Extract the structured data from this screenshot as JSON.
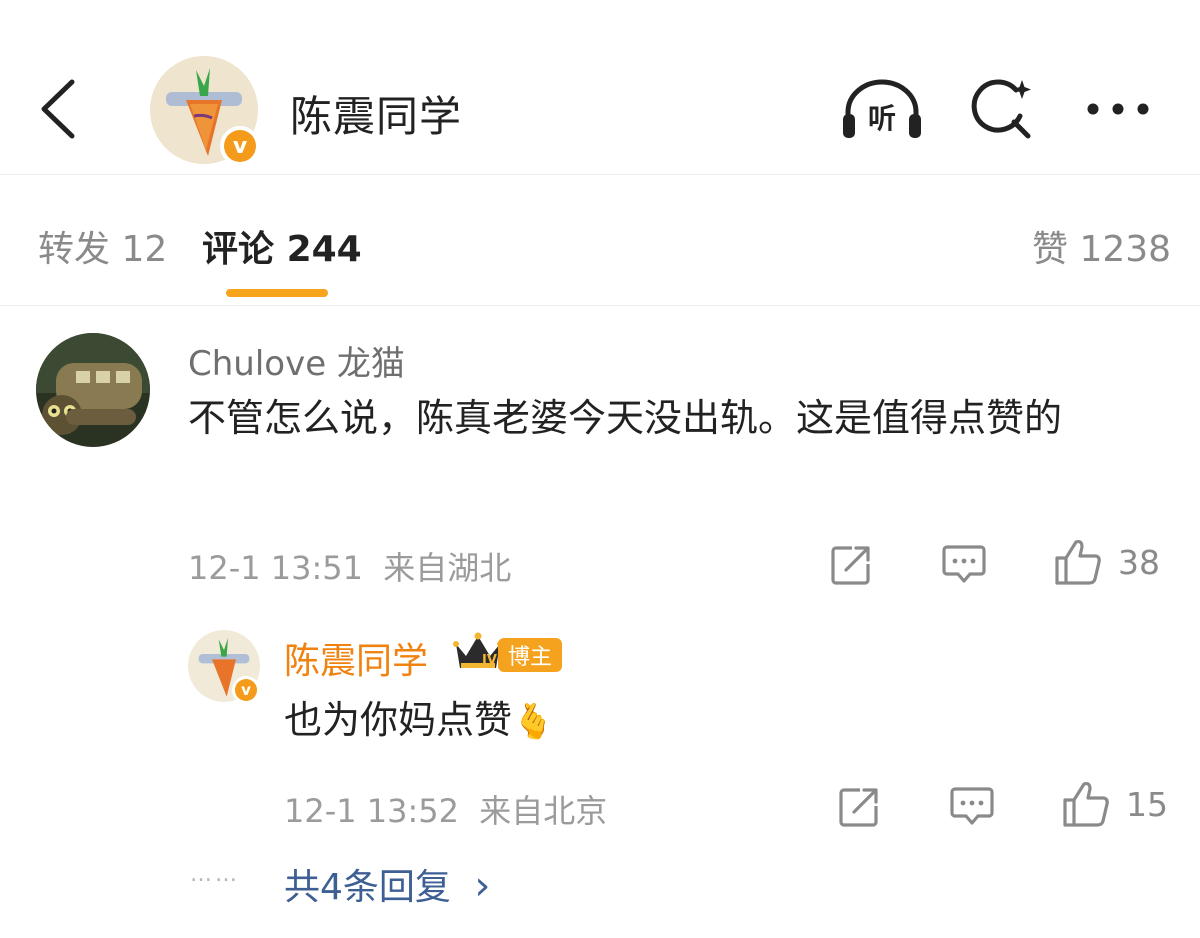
{
  "header": {
    "title": "陈震同学",
    "listen_label": "听",
    "icons": [
      "back-icon",
      "headphones-icon",
      "search-sparkle-icon",
      "more-icon"
    ],
    "verify_badge": "v"
  },
  "tabs": [
    {
      "label": "转发",
      "count": "12"
    },
    {
      "label": "评论",
      "count": "244"
    },
    {
      "label": "赞",
      "count": "1238"
    }
  ],
  "comment": {
    "username": "Chulove 龙猫",
    "text": "不管怎么说，陈真老婆今天没出轨。这是值得点赞的",
    "time": "12-1 13:51",
    "location": "来自湖北",
    "like_count": "38"
  },
  "reply": {
    "username": "陈震同学",
    "rank": "IV",
    "badge": "博主",
    "text": "也为你妈点赞",
    "emoji": "🫰",
    "time": "12-1 13:52",
    "location": "来自北京",
    "like_count": "15"
  },
  "more_replies": {
    "dots": "……",
    "label": "共4条回复",
    "chevron": "›"
  },
  "colors": {
    "accent": "#f7a51c",
    "reply_name": "#f0820f",
    "link": "#3e5f93"
  }
}
